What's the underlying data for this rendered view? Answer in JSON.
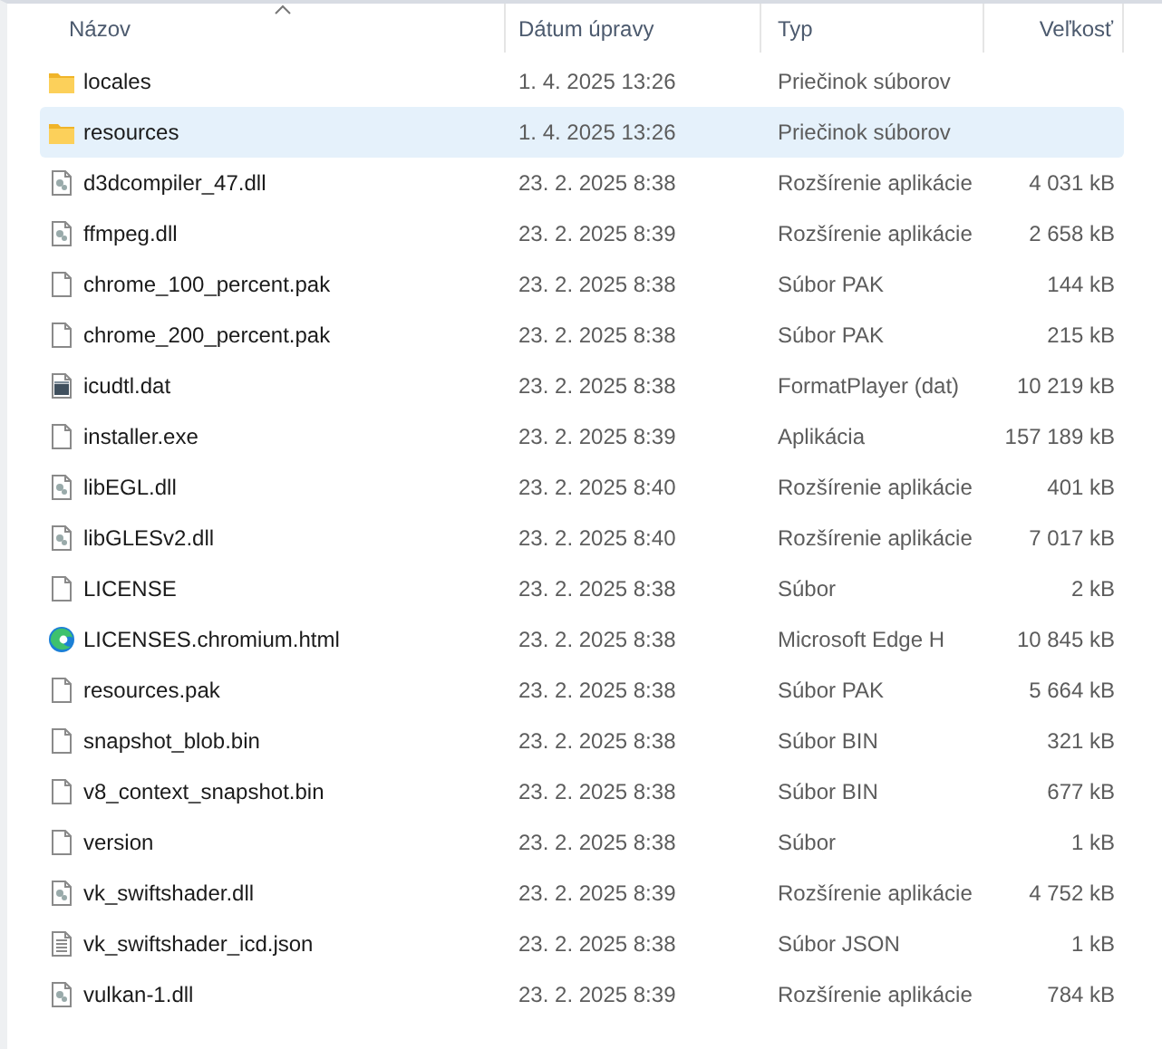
{
  "columns": [
    {
      "label": "Názov",
      "sorted": true
    },
    {
      "label": "Dátum úpravy",
      "sorted": false
    },
    {
      "label": "Typ",
      "sorted": false
    },
    {
      "label": "Veľkosť",
      "sorted": false
    }
  ],
  "rows": [
    {
      "kind": "folder",
      "name": "locales",
      "date": "1. 4. 2025 13:26",
      "type": "Priečinok súborov",
      "selected": false
    },
    {
      "kind": "folder",
      "name": "resources",
      "date": "1. 4. 2025 13:26",
      "type": "Priečinok súborov",
      "selected": true
    },
    {
      "kind": "dll",
      "name": "d3dcompiler_47.dll",
      "date": "23. 2. 2025 8:38",
      "type": "Rozšírenie aplikácie",
      "size": "4 031 kB",
      "selected": false
    },
    {
      "kind": "dll",
      "name": "ffmpeg.dll",
      "date": "23. 2. 2025 8:39",
      "type": "Rozšírenie aplikácie",
      "size": "2 658 kB",
      "selected": false
    },
    {
      "kind": "file",
      "name": "chrome_100_percent.pak",
      "date": "23. 2. 2025 8:38",
      "type": "Súbor PAK",
      "size": "144 kB",
      "selected": false
    },
    {
      "kind": "file",
      "name": "chrome_200_percent.pak",
      "date": "23. 2. 2025 8:38",
      "type": "Súbor PAK",
      "size": "215 kB",
      "selected": false
    },
    {
      "kind": "media",
      "name": "icudtl.dat",
      "date": "23. 2. 2025 8:38",
      "type": "FormatPlayer (dat)",
      "size": "10 219 kB",
      "selected": false
    },
    {
      "kind": "file",
      "name": "installer.exe",
      "date": "23. 2. 2025 8:39",
      "type": "Aplikácia",
      "size": "157 189 kB",
      "selected": false
    },
    {
      "kind": "dll",
      "name": "libEGL.dll",
      "date": "23. 2. 2025 8:40",
      "type": "Rozšírenie aplikácie",
      "size": "401 kB",
      "selected": false
    },
    {
      "kind": "dll",
      "name": "libGLESv2.dll",
      "date": "23. 2. 2025 8:40",
      "type": "Rozšírenie aplikácie",
      "size": "7 017 kB",
      "selected": false
    },
    {
      "kind": "file",
      "name": "LICENSE",
      "date": "23. 2. 2025 8:38",
      "type": "Súbor",
      "size": "2 kB",
      "selected": false
    },
    {
      "kind": "browser",
      "name": "LICENSES.chromium.html",
      "date": "23. 2. 2025 8:38",
      "type": "Microsoft Edge H",
      "size": "10 845 kB",
      "selected": false
    },
    {
      "kind": "file",
      "name": "resources.pak",
      "date": "23. 2. 2025 8:38",
      "type": "Súbor PAK",
      "size": "5 664 kB",
      "selected": false
    },
    {
      "kind": "file",
      "name": "snapshot_blob.bin",
      "date": "23. 2. 2025 8:38",
      "type": "Súbor BIN",
      "size": "321 kB",
      "selected": false
    },
    {
      "kind": "file",
      "name": "v8_context_snapshot.bin",
      "date": "23. 2. 2025 8:38",
      "type": "Súbor BIN",
      "size": "677 kB",
      "selected": false
    },
    {
      "kind": "file",
      "name": "version",
      "date": "23. 2. 2025 8:38",
      "type": "Súbor",
      "size": "1 kB",
      "selected": false
    },
    {
      "kind": "dll",
      "name": "vk_swiftshader.dll",
      "date": "23. 2. 2025 8:39",
      "type": "Rozšírenie aplikácie",
      "size": "4 752 kB",
      "selected": false
    },
    {
      "kind": "text",
      "name": "vk_swiftshader_icd.json",
      "date": "23. 2. 2025 8:38",
      "type": "Súbor JSON",
      "size": "1 kB",
      "selected": false
    },
    {
      "kind": "dll",
      "name": "vulkan-1.dll",
      "date": "23. 2. 2025 8:39",
      "type": "Rozšírenie aplikácie",
      "size": "784 kB",
      "selected": false
    }
  ]
}
